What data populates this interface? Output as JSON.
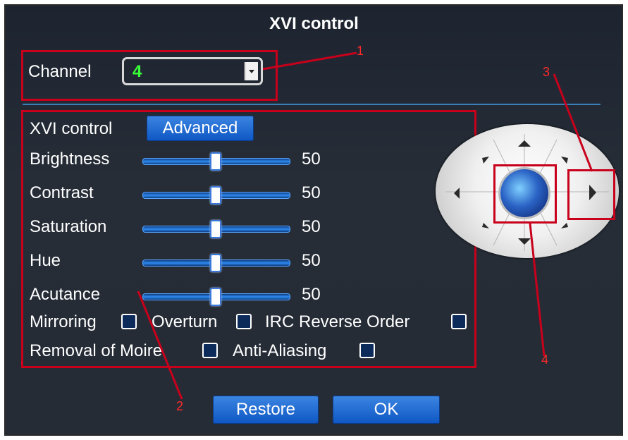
{
  "dialog": {
    "title": "XVI control"
  },
  "channel": {
    "label": "Channel",
    "value": "4"
  },
  "xvi": {
    "label": "XVI control",
    "advanced_button": "Advanced"
  },
  "sliders": [
    {
      "label": "Brightness",
      "value": "50",
      "level": 0.5
    },
    {
      "label": "Contrast",
      "value": "50",
      "level": 0.5
    },
    {
      "label": "Saturation",
      "value": "50",
      "level": 0.5
    },
    {
      "label": "Hue",
      "value": "50",
      "level": 0.5
    },
    {
      "label": "Acutance",
      "value": "50",
      "level": 0.5
    }
  ],
  "options": {
    "mirroring": "Mirroring",
    "overturn": "Overturn",
    "irc_reverse_order": "IRC Reverse Order",
    "removal_of_moire": "Removal of Moire",
    "anti_aliasing": "Anti-Aliasing"
  },
  "buttons": {
    "restore": "Restore",
    "ok": "OK"
  },
  "annotations": {
    "a1": "1",
    "a2": "2",
    "a3": "3",
    "a4": "4"
  },
  "colors": {
    "panel_bg": "#232a34",
    "accent_blue": "#1667d6",
    "channel_value": "#39ff39",
    "annotation_red": "#c8001c"
  },
  "icons": {
    "dropdown": "chevron-down-icon",
    "ptz": "ptz-joystick-icon"
  }
}
